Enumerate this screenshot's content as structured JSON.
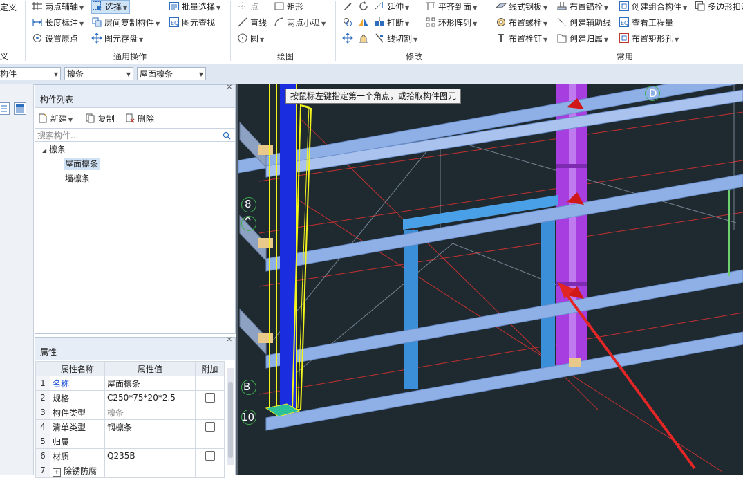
{
  "ribbon": {
    "left_partial": {
      "top": "定义",
      "bottom": "义"
    },
    "general": {
      "label": "通用操作",
      "two_point_axis": "两点辅轴",
      "select": "选择",
      "batch_select": "批量选择",
      "length_dim": "长度标注",
      "cross_floor_copy": "层间复制构件",
      "find_element": "图元查找",
      "set_origin": "设置原点",
      "element_save": "图元存盘"
    },
    "draw": {
      "label": "绘图",
      "point": "点",
      "rect": "矩形",
      "line": "直线",
      "two_point_arc": "两点小弧",
      "circle": "圆"
    },
    "modify": {
      "label": "修改",
      "extend": "延伸",
      "align_face": "平齐到面",
      "break": "打断",
      "ring_array": "环形阵列",
      "line_cut": "线切割"
    },
    "common": {
      "label": "常用",
      "linear_plate": "线式钢板",
      "place_anchor": "布置锚栓",
      "create_group": "创建组合构件",
      "polygon_hole": "多边形扣洞",
      "place_bolt": "布置螺栓",
      "create_aux_line": "创建辅助线",
      "view_quantity": "查看工程量",
      "place_stud": "布置栓钉",
      "create_belonging": "创建归属",
      "place_rect_hole": "布置矩形孔"
    }
  },
  "combobar": {
    "combo1": "构件",
    "combo2": "檩条",
    "combo3": "屋面檩条"
  },
  "component_list": {
    "title": "构件列表",
    "new": "新建",
    "copy": "复制",
    "delete": "删除",
    "search_placeholder": "搜索构件...",
    "tree_root": "檩条",
    "tree_items": [
      "屋面檩条",
      "墙檩条"
    ]
  },
  "properties": {
    "title": "属性",
    "headers": [
      "属性名称",
      "属性值",
      "附加"
    ],
    "rows": [
      {
        "n": "1",
        "name": "名称",
        "value": "屋面檩条",
        "check": false
      },
      {
        "n": "2",
        "name": "规格",
        "value": "C250*75*20*2.5",
        "check": true
      },
      {
        "n": "3",
        "name": "构件类型",
        "value": "檩条",
        "check": false
      },
      {
        "n": "4",
        "name": "清单类型",
        "value": "钢檩条",
        "check": true
      },
      {
        "n": "5",
        "name": "归属",
        "value": "",
        "check": false
      },
      {
        "n": "6",
        "name": "材质",
        "value": "Q235B",
        "check": true
      },
      {
        "n": "7",
        "name": "除锈防腐",
        "value": "",
        "check": false
      }
    ]
  },
  "viewport": {
    "tooltip": "按鼠标左键指定第一个角点，或拾取构件图元",
    "axis_labels": {
      "a8": "8",
      "a9": "9",
      "a10": "10",
      "aB": "B",
      "aD": "D"
    }
  }
}
